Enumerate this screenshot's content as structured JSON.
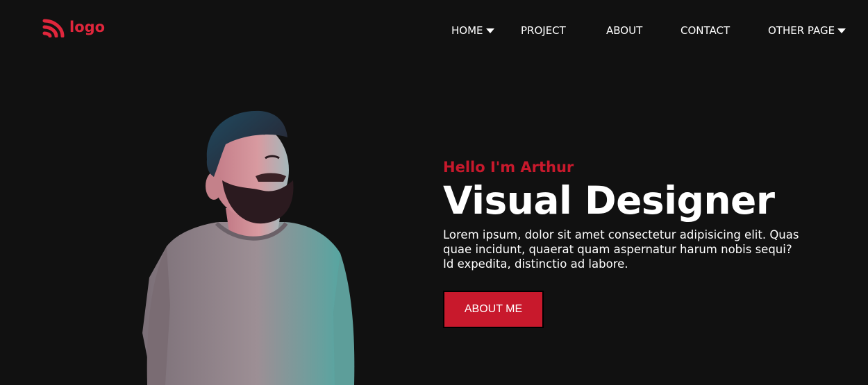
{
  "brand": {
    "logo_text": "logo",
    "accent_color": "#e0263c",
    "icon": "rss-waves-icon"
  },
  "nav": {
    "items": [
      {
        "label": "HOME",
        "has_dropdown": true
      },
      {
        "label": "PROJECT",
        "has_dropdown": false
      },
      {
        "label": "ABOUT",
        "has_dropdown": false
      },
      {
        "label": "CONTACT",
        "has_dropdown": false
      },
      {
        "label": "OTHER PAGE",
        "has_dropdown": true
      }
    ]
  },
  "hero": {
    "greeting": "Hello I'm Arthur",
    "title": "Visual Designer",
    "description": "Lorem ipsum, dolor sit amet consectetur adipisicing elit. Quas quae incidunt, quaerat quam aspernatur harum nobis sequi? Id expedita, distinctio ad labore.",
    "button_label": "ABOUT ME",
    "button_color": "#c8192c"
  },
  "colors": {
    "background": "#111111",
    "text": "#ffffff"
  }
}
